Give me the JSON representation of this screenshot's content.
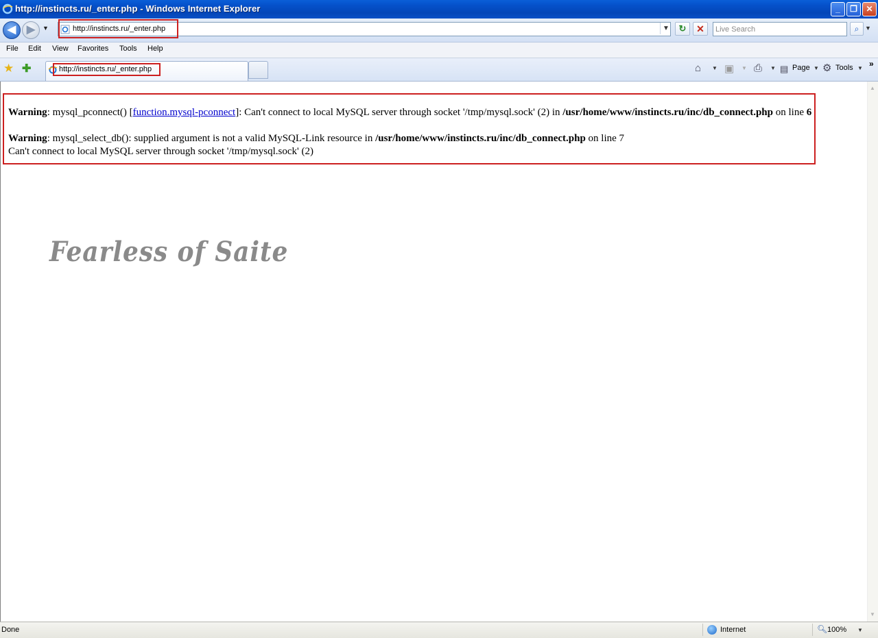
{
  "window": {
    "title": "http://instincts.ru/_enter.php - Windows Internet Explorer",
    "caption_buttons": {
      "minimize": "_",
      "maximize": "❐",
      "close": "✕"
    }
  },
  "nav": {
    "back_glyph": "◀",
    "forward_glyph": "▶",
    "address_url": "http://instincts.ru/_enter.php",
    "refresh_glyph": "↻",
    "stop_glyph": "✕",
    "search_placeholder": "Live Search",
    "search_glyph": "⌕"
  },
  "menu": {
    "items": [
      "File",
      "Edit",
      "View",
      "Favorites",
      "Tools",
      "Help"
    ]
  },
  "tabs": {
    "active_label": "http://instincts.ru/_enter.php"
  },
  "command_bar": {
    "page_label": "Page",
    "tools_label": "Tools",
    "chevron": "»"
  },
  "content": {
    "errors": {
      "line1": {
        "label": "Warning",
        "text_a": ": mysql_pconnect() [",
        "link": "function.mysql-pconnect",
        "text_b": "]: Can't connect to local MySQL server through socket '/tmp/mysql.sock' (2) in ",
        "path": "/usr/home/www/instincts.ru/inc/db_connect.php",
        "text_c": " on line ",
        "line_no": "6"
      },
      "line2": {
        "label": "Warning",
        "text_a": ": mysql_select_db(): supplied argument is not a valid MySQL-Link resource in ",
        "path": "/usr/home/www/instincts.ru/inc/db_connect.php",
        "text_c": " on line ",
        "line_no": "7"
      },
      "line3": "Can't connect to local MySQL server through socket '/tmp/mysql.sock' (2)"
    },
    "logo_text": "Fearless of Saite"
  },
  "status": {
    "text": "Done",
    "zone": "Internet",
    "zoom": "100%"
  }
}
